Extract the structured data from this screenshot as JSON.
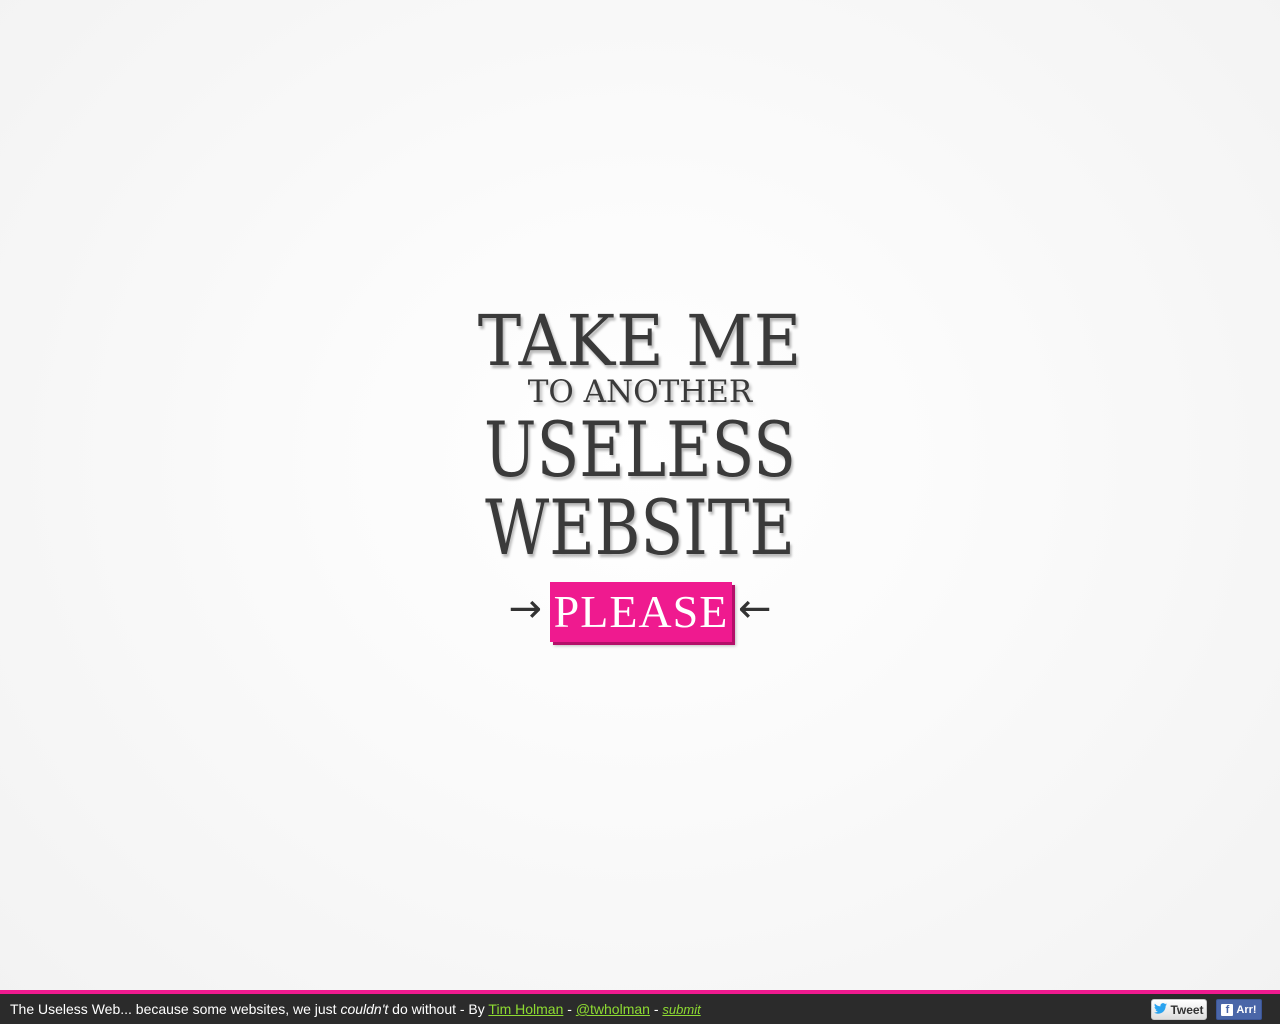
{
  "headline": {
    "line1": "TAKE ME",
    "line2": "TO ANOTHER",
    "line3": "USELESS",
    "line4": "WEBSITE"
  },
  "please_button": {
    "label": "PLEASE",
    "left_arrow": "→",
    "right_arrow": "←"
  },
  "footer": {
    "intro": "The Useless Web... because some websites, we just ",
    "emphasis": "couldn't",
    "after_emphasis": " do without - By ",
    "author_link": "Tim Holman",
    "separator1": " - ",
    "twitter_link": "@twholman",
    "separator2": " - ",
    "submit_link": "submit",
    "tweet_label": "Tweet",
    "tweet_icon": "twitter-bird-icon",
    "fb_label": "Arr!",
    "fb_icon": "facebook-icon"
  },
  "colors": {
    "accent": "#ef1a8f",
    "link": "#8edc32",
    "footer_bg": "#2b2b2b",
    "text": "#3a3a3a"
  }
}
